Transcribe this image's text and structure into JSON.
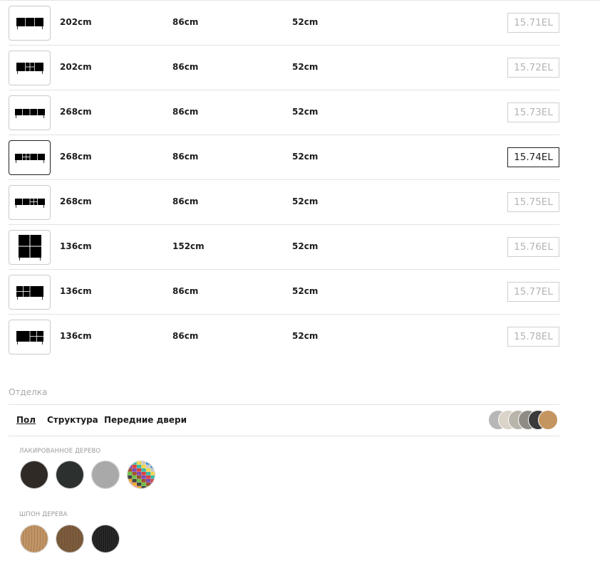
{
  "products": [
    {
      "thumb": "sideboard-3-door-icon",
      "width": "202cm",
      "height": "86cm",
      "depth": "52cm",
      "code": "15.71EL",
      "selected": false
    },
    {
      "thumb": "sideboard-3-door-drawers-icon",
      "width": "202cm",
      "height": "86cm",
      "depth": "52cm",
      "code": "15.72EL",
      "selected": false
    },
    {
      "thumb": "sideboard-4-door-icon",
      "width": "268cm",
      "height": "86cm",
      "depth": "52cm",
      "code": "15.73EL",
      "selected": false
    },
    {
      "thumb": "sideboard-4-door-drawers-icon",
      "width": "268cm",
      "height": "86cm",
      "depth": "52cm",
      "code": "15.74EL",
      "selected": true
    },
    {
      "thumb": "sideboard-4-door-drawers-right-icon",
      "width": "268cm",
      "height": "86cm",
      "depth": "52cm",
      "code": "15.75EL",
      "selected": false
    },
    {
      "thumb": "highboard-4-door-icon",
      "width": "136cm",
      "height": "152cm",
      "depth": "52cm",
      "code": "15.76EL",
      "selected": false
    },
    {
      "thumb": "sideboard-2-door-drawers-icon",
      "width": "136cm",
      "height": "86cm",
      "depth": "52cm",
      "code": "15.77EL",
      "selected": false
    },
    {
      "thumb": "sideboard-2-door-drawers-right-icon",
      "width": "136cm",
      "height": "86cm",
      "depth": "52cm",
      "code": "15.78EL",
      "selected": false
    }
  ],
  "finish": {
    "title": "Отделка",
    "tabs": [
      "Пол",
      "Структура",
      "Передние двери"
    ],
    "active_tab": 0,
    "preview_colors": [
      "#b7b7b7",
      "#d9d3c8",
      "#b9b5ab",
      "#8f8c86",
      "#3a3a3a",
      "#c49560"
    ],
    "groups": [
      {
        "label": "ЛАКИРОВАННОЕ ДЕРЕВО",
        "swatches": [
          {
            "name": "dark-brown",
            "color": "#2f2a26"
          },
          {
            "name": "anthracite",
            "color": "#2c302e"
          },
          {
            "name": "light-grey",
            "color": "#a9a9a9"
          },
          {
            "name": "color-palette",
            "color": "multi"
          }
        ]
      },
      {
        "label": "ШПОН ДЕРЕВА",
        "swatches": [
          {
            "name": "natural-oak",
            "color": "#c29566"
          },
          {
            "name": "walnut",
            "color": "#7d5c3e"
          },
          {
            "name": "black-oak",
            "color": "#1e1e1e"
          }
        ]
      }
    ]
  }
}
